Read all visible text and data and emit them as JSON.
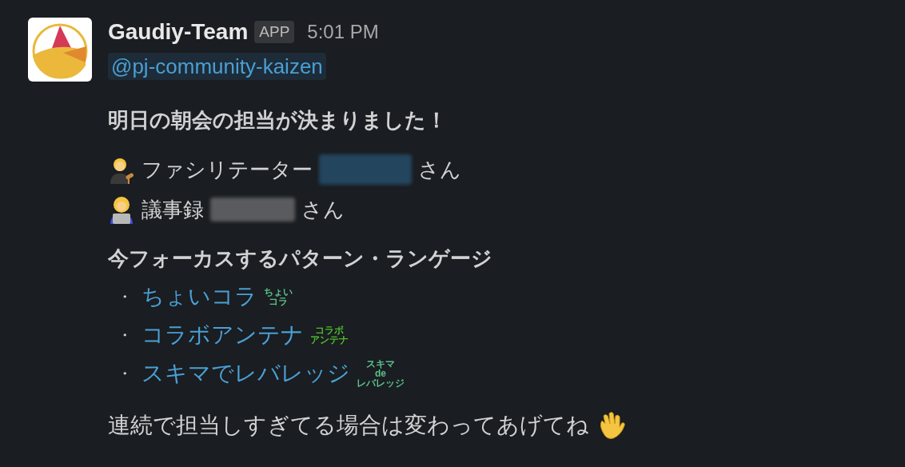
{
  "message": {
    "sender": "Gaudiy-Team",
    "badge": "APP",
    "time": "5:01 PM",
    "mention": "@pj-community-kaizen",
    "heading": "明日の朝会の担当が決まりました！",
    "roles": [
      {
        "kind": "facilitator",
        "label": "ファシリテーター",
        "name_highlighted": true,
        "suffix": "さん"
      },
      {
        "kind": "note-taker",
        "label": "議事録",
        "name_highlighted": false,
        "suffix": "さん"
      }
    ],
    "patterns_heading": "今フォーカスするパターン・ランゲージ",
    "patterns": [
      {
        "bullet": "・",
        "link": "ちょいコラ",
        "stamp": [
          "ちょい",
          "コラ"
        ],
        "color": "#5bbf8a"
      },
      {
        "bullet": "・",
        "link": "コラボアンテナ",
        "stamp": [
          "コラボ",
          "アンテナ"
        ],
        "color": "#4cbb2c"
      },
      {
        "bullet": "・",
        "link": "スキマでレバレッジ",
        "stamp": [
          "スキマ",
          "de",
          "レバレッジ"
        ],
        "color": "#5bbf8a"
      }
    ],
    "footer": "連続で担当しすぎてる場合は変わってあげてね"
  }
}
